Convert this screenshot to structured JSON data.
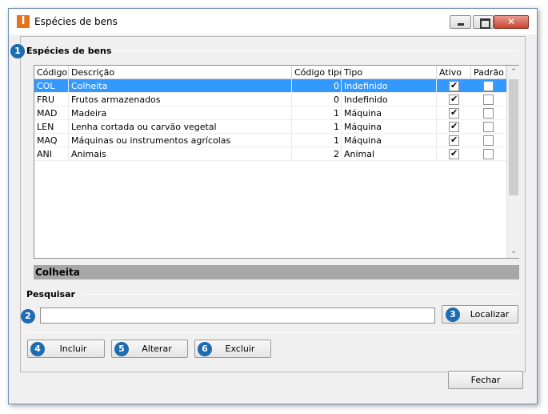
{
  "window": {
    "title": "Espécies de bens",
    "icon": "I",
    "close_glyph": "✕"
  },
  "section1": {
    "badge": "1",
    "title": "Espécies de bens"
  },
  "grid": {
    "columns": [
      "Código",
      "Descrição",
      "Código tipo",
      "Tipo",
      "Ativo",
      "Padrão"
    ],
    "rows": [
      {
        "codigo": "COL",
        "descricao": "Colheita",
        "codigo_tipo": "0",
        "tipo": "Indefinido",
        "ativo": true,
        "padrao": false,
        "selected": true
      },
      {
        "codigo": "FRU",
        "descricao": "Frutos armazenados",
        "codigo_tipo": "0",
        "tipo": "Indefinido",
        "ativo": true,
        "padrao": false,
        "selected": false
      },
      {
        "codigo": "MAD",
        "descricao": "Madeira",
        "codigo_tipo": "1",
        "tipo": "Máquina",
        "ativo": true,
        "padrao": false,
        "selected": false
      },
      {
        "codigo": "LEN",
        "descricao": "Lenha cortada ou carvão vegetal",
        "codigo_tipo": "1",
        "tipo": "Máquina",
        "ativo": true,
        "padrao": false,
        "selected": false
      },
      {
        "codigo": "MAQ",
        "descricao": "Máquinas ou instrumentos agrícolas",
        "codigo_tipo": "1",
        "tipo": "Máquina",
        "ativo": true,
        "padrao": false,
        "selected": false
      },
      {
        "codigo": "ANI",
        "descricao": "Animais",
        "codigo_tipo": "2",
        "tipo": "Animal",
        "ativo": true,
        "padrao": false,
        "selected": false
      }
    ],
    "scroll_up": "⌃",
    "scroll_down": "⌄"
  },
  "selected_label": "Colheita",
  "search": {
    "title": "Pesquisar",
    "badge": "2",
    "value": "",
    "placeholder": "",
    "button_badge": "3",
    "button_label": "Localizar"
  },
  "actions": [
    {
      "badge": "4",
      "label": "Incluir"
    },
    {
      "badge": "5",
      "label": "Alterar"
    },
    {
      "badge": "6",
      "label": "Excluir"
    }
  ],
  "footer": {
    "close_label": "Fechar"
  },
  "colors": {
    "accent": "#1e6bb0",
    "selection": "#3399ff",
    "icon": "#e2721b"
  }
}
